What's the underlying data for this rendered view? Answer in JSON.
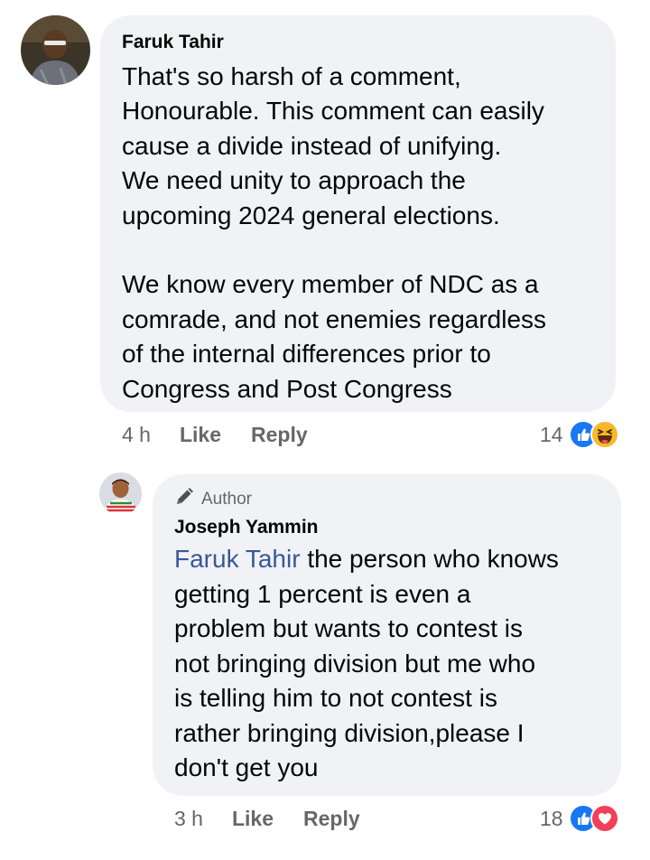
{
  "comments": [
    {
      "author": "Faruk Tahir",
      "text": "That's so harsh of a comment,\nHonourable. This comment can easily\ncause a divide instead of unifying.\nWe need unity to approach the\nupcoming 2024 general elections.\n\nWe know every member of NDC as a\ncomrade, and not enemies regardless\nof the internal differences prior to\nCongress and Post Congress",
      "time": "4 h",
      "like_label": "Like",
      "reply_label": "Reply",
      "reaction_count": "14",
      "reactions": [
        "like-icon",
        "haha-icon"
      ]
    }
  ],
  "reply": {
    "badge": "Author",
    "badge_icon": "pencil-icon",
    "author": "Joseph Yammin",
    "mention": "Faruk Tahir",
    "text": " the person who knows\ngetting 1 percent is even a\nproblem but wants to contest is\nnot bringing division but me who\nis telling him to not contest is\nrather bringing division,please I\ndon't get you",
    "time": "3 h",
    "like_label": "Like",
    "reply_label": "Reply",
    "reaction_count": "18",
    "reactions": [
      "like-icon",
      "love-icon"
    ]
  },
  "colors": {
    "bubble": "#f0f2f5",
    "meta_text": "#65676b",
    "mention": "#385898",
    "like_blue": "#1877f2",
    "love_red": "#f33e58",
    "haha_yellow": "#f7b928"
  }
}
